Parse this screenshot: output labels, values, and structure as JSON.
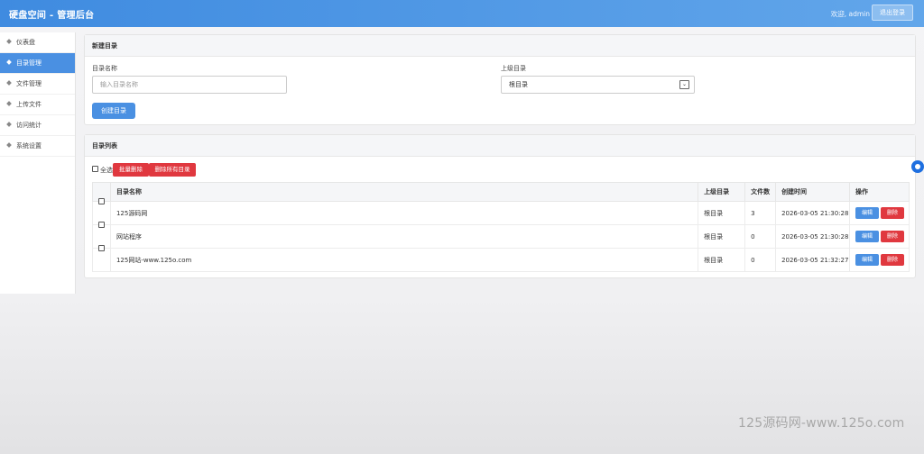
{
  "header": {
    "title": "硬盘空间 - 管理后台",
    "welcome": "欢迎, admin",
    "logout_label": "退出登录"
  },
  "sidebar": {
    "items": [
      {
        "label": "仪表盘",
        "active": false
      },
      {
        "label": "目录管理",
        "active": true
      },
      {
        "label": "文件管理",
        "active": false
      },
      {
        "label": "上传文件",
        "active": false
      },
      {
        "label": "访问统计",
        "active": false
      },
      {
        "label": "系统设置",
        "active": false
      }
    ]
  },
  "create_panel": {
    "title": "新建目录",
    "name_label": "目录名称",
    "name_placeholder": "输入目录名称",
    "parent_label": "上级目录",
    "parent_selected": "根目录",
    "create_button": "创建目录"
  },
  "list_panel": {
    "title": "目录列表",
    "select_all_label": "全选",
    "batch_delete_label": "批量删除",
    "delete_all_label": "删除所有目录",
    "columns": [
      "目录名称",
      "上级目录",
      "文件数",
      "创建时间",
      "操作"
    ],
    "rows": [
      {
        "name": "125源码网",
        "parent": "根目录",
        "count": "3",
        "created": "2026-03-05 21:30:28"
      },
      {
        "name": "网站程序",
        "parent": "根目录",
        "count": "0",
        "created": "2026-03-05 21:30:28"
      },
      {
        "name": "125网站-www.125o.com",
        "parent": "根目录",
        "count": "0",
        "created": "2026-03-05 21:32:27"
      }
    ],
    "edit_label": "编辑",
    "delete_label": "删除"
  },
  "watermark": "125源码网-www.125o.com",
  "colors": {
    "accent": "#4a90e2",
    "danger": "#e0383f",
    "header_start": "#3f8be0",
    "header_end": "#62a6ea"
  }
}
